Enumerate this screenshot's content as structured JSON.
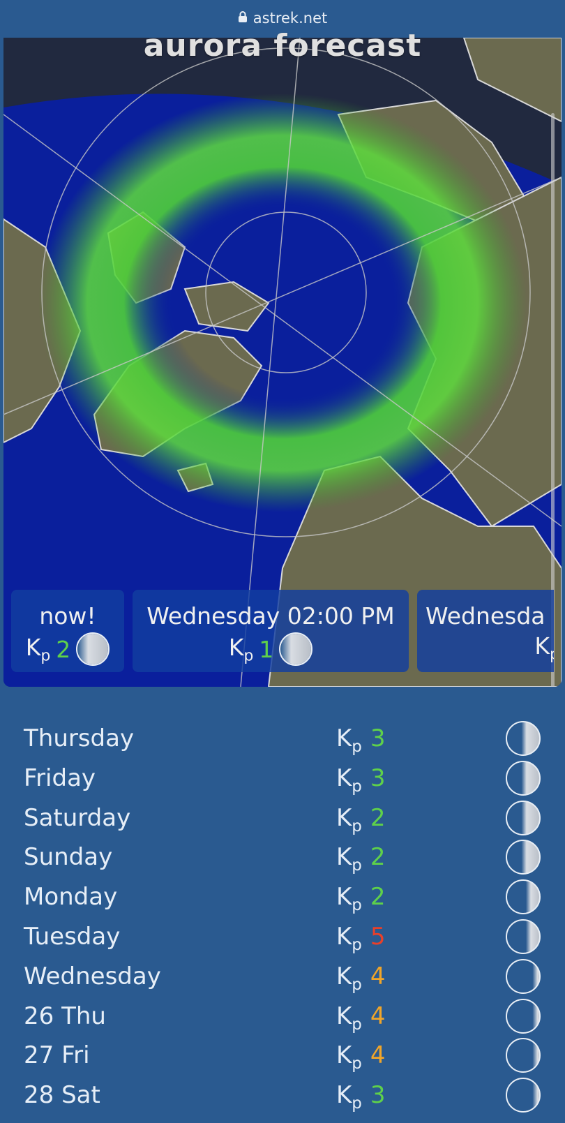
{
  "browser": {
    "url": "astrek.net"
  },
  "map": {
    "title": "aurora forecast"
  },
  "forecast_strip": [
    {
      "when": "now!",
      "kp": "2",
      "kp_color": "#5fd14a"
    },
    {
      "when": "Wednesday 02:00 PM",
      "kp": "1",
      "kp_color": "#5fd14a"
    },
    {
      "when": "Wednesda",
      "kp": "",
      "kp_color": "#5fd14a"
    }
  ],
  "kp_label": "K",
  "kp_sub": "p",
  "daily": [
    {
      "day": "Thursday",
      "kp": "3",
      "level": "green",
      "moon_phase": "waning-gibbous"
    },
    {
      "day": "Friday",
      "kp": "3",
      "level": "green",
      "moon_phase": "waning-gibbous"
    },
    {
      "day": "Saturday",
      "kp": "2",
      "level": "green",
      "moon_phase": "waning-gibbous"
    },
    {
      "day": "Sunday",
      "kp": "2",
      "level": "green",
      "moon_phase": "waning-gibbous"
    },
    {
      "day": "Monday",
      "kp": "2",
      "level": "green",
      "moon_phase": "last-quarter"
    },
    {
      "day": "Tuesday",
      "kp": "5",
      "level": "red",
      "moon_phase": "last-quarter"
    },
    {
      "day": "Wednesday",
      "kp": "4",
      "level": "orange",
      "moon_phase": "waning-crescent"
    },
    {
      "day": "26 Thu",
      "kp": "4",
      "level": "orange",
      "moon_phase": "waning-crescent"
    },
    {
      "day": "27 Fri",
      "kp": "4",
      "level": "orange",
      "moon_phase": "waning-crescent"
    },
    {
      "day": "28 Sat",
      "kp": "3",
      "level": "green",
      "moon_phase": "waning-crescent"
    }
  ],
  "colors": {
    "background": "#2a5a90",
    "kp_green": "#5fd14a",
    "kp_orange": "#f0a52a",
    "kp_red": "#e8402a"
  }
}
